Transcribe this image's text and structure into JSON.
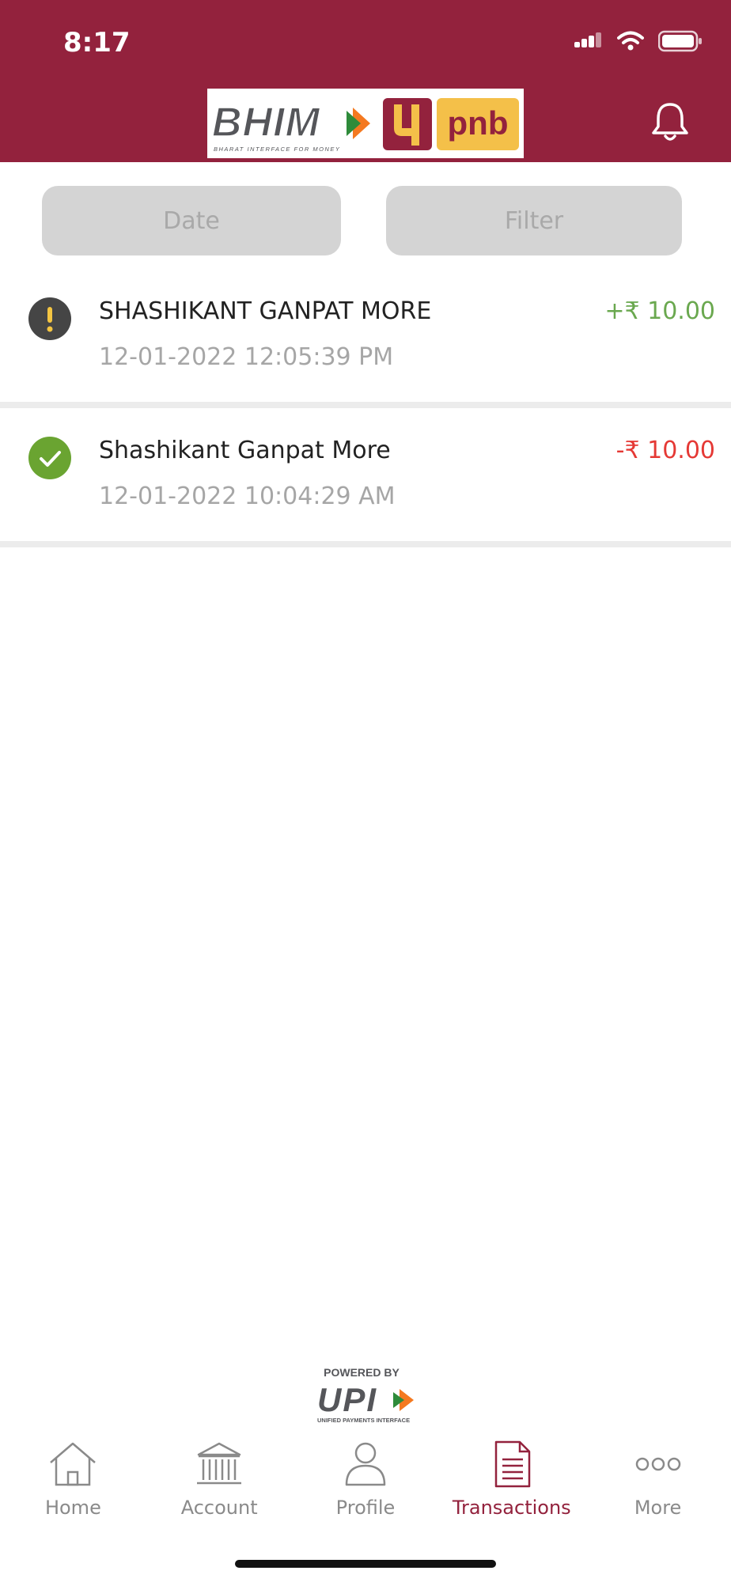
{
  "status_bar": {
    "time": "8:17"
  },
  "header": {
    "logo_bhim": "BHIM",
    "logo_bhim_tagline": "BHARAT INTERFACE FOR MONEY",
    "logo_pnb": "pnb"
  },
  "toolbar": {
    "date_label": "Date",
    "filter_label": "Filter"
  },
  "transactions": [
    {
      "name": "SHASHIKANT GANPAT MORE",
      "datetime": "12-01-2022 12:05:39 PM",
      "amount": "+₹ 10.00",
      "status": "pending",
      "amount_color": "#6aa84f"
    },
    {
      "name": "Shashikant Ganpat More",
      "datetime": "12-01-2022 10:04:29 AM",
      "amount": "-₹ 10.00",
      "status": "success",
      "amount_color": "#e53935"
    }
  ],
  "footer": {
    "powered_by": "POWERED BY",
    "upi": "UPI",
    "upi_tagline": "UNIFIED PAYMENTS INTERFACE"
  },
  "nav": [
    {
      "label": "Home",
      "icon": "home-icon"
    },
    {
      "label": "Account",
      "icon": "bank-icon"
    },
    {
      "label": "Profile",
      "icon": "user-icon"
    },
    {
      "label": "Transactions",
      "icon": "document-icon",
      "active": true
    },
    {
      "label": "More",
      "icon": "more-icon"
    }
  ],
  "colors": {
    "brand": "#93223d",
    "credit": "#6aa84f",
    "debit": "#e53935"
  }
}
